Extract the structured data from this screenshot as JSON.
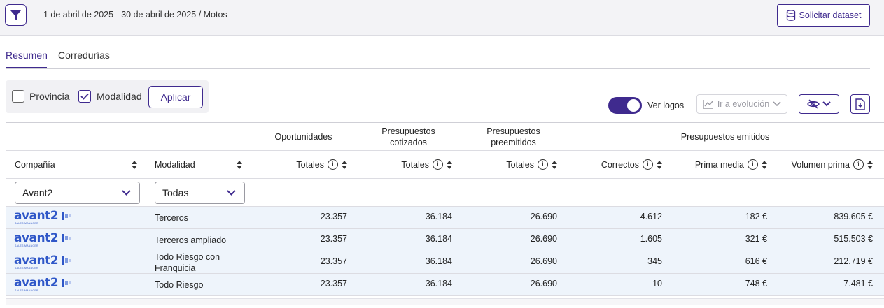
{
  "header": {
    "breadcrumb": "1 de abril de 2025 - 30 de abril de 2025 / Motos",
    "dataset_button": "Solicitar dataset"
  },
  "tabs": [
    {
      "label": "Resumen",
      "active": true
    },
    {
      "label": "Corredurías",
      "active": false
    }
  ],
  "filters": {
    "provincia": {
      "label": "Provincia",
      "checked": false
    },
    "modalidad": {
      "label": "Modalidad",
      "checked": true
    },
    "apply_label": "Aplicar"
  },
  "toolbar": {
    "ver_logos_label": "Ver logos",
    "ver_logos_on": true,
    "evolucion_label": "Ir a evolución"
  },
  "table": {
    "group_headers": [
      "Oportunidades",
      "Presupuestos cotizados",
      "Presupuestos preemitidos",
      "Presupuestos emitidos"
    ],
    "columns": [
      "Compañía",
      "Modalidad",
      "Totales",
      "Totales",
      "Totales",
      "Correctos",
      "Prima media",
      "Volumen prima"
    ],
    "company_filter": "Avant2",
    "modalidad_filter": "Todas",
    "rows": [
      {
        "company": "avant2",
        "company_sub": "SALES MANAGER",
        "modalidad": "Terceros",
        "values": [
          "23.357",
          "36.184",
          "26.690",
          "4.612",
          "182 €",
          "839.605 €"
        ]
      },
      {
        "company": "avant2",
        "company_sub": "SALES MANAGER",
        "modalidad": "Terceros ampliado",
        "values": [
          "23.357",
          "36.184",
          "26.690",
          "1.605",
          "321 €",
          "515.503 €"
        ]
      },
      {
        "company": "avant2",
        "company_sub": "SALES MANAGER",
        "modalidad": "Todo Riesgo con Franquicia",
        "values": [
          "23.357",
          "36.184",
          "26.690",
          "345",
          "616 €",
          "212.719 €"
        ]
      },
      {
        "company": "avant2",
        "company_sub": "SALES MANAGER",
        "modalidad": "Todo Riesgo",
        "values": [
          "23.357",
          "36.184",
          "26.690",
          "10",
          "748 €",
          "7.481 €"
        ]
      }
    ]
  },
  "colors": {
    "accent": "#3f2a8e",
    "row_bg": "#eef4fb",
    "logo": "#2f57c8"
  },
  "icons": [
    "filter-icon",
    "database-icon",
    "check-icon",
    "chart-line-icon",
    "chevron-down-icon",
    "eye-off-icon",
    "download-file-icon",
    "info-icon",
    "sort-icon"
  ]
}
